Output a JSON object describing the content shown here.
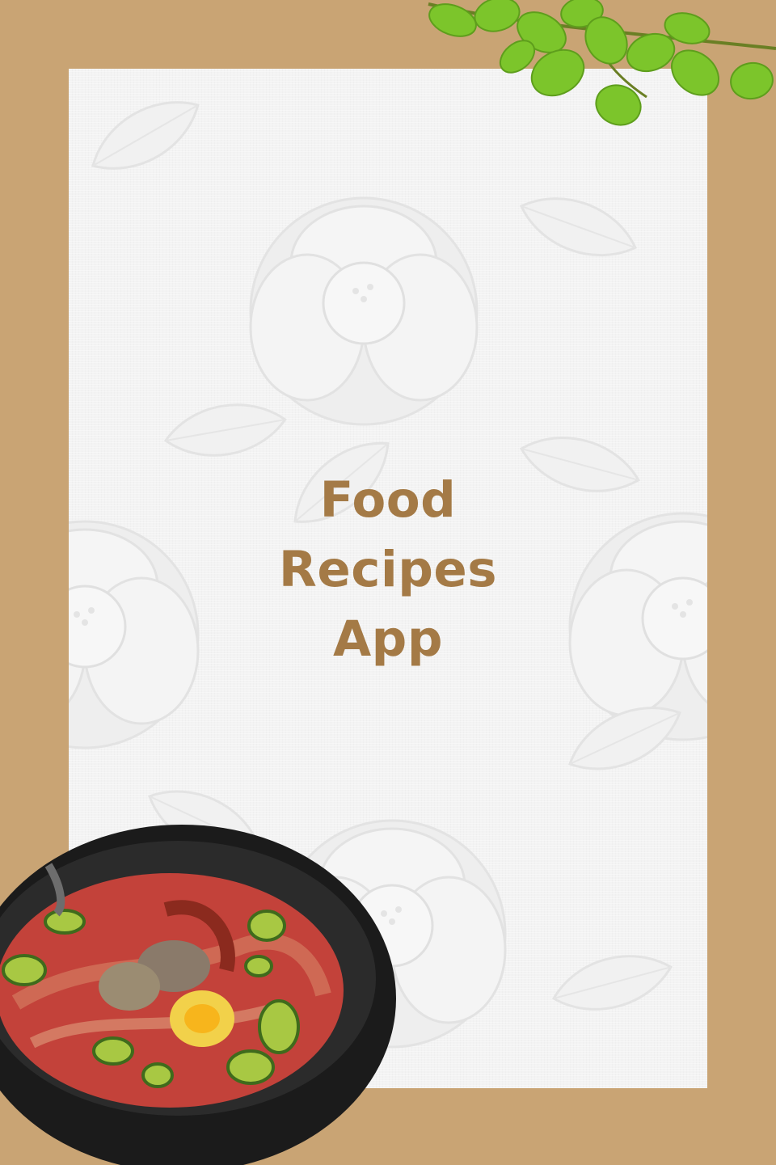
{
  "splash": {
    "title_lines": [
      "Food",
      "Recipes",
      "App"
    ]
  },
  "decor": {
    "frame_icon": "paper-frame",
    "leaves_icon": "leaf-branch-icon",
    "pot_icon": "stew-pot-icon"
  },
  "colors": {
    "frame": "#c9a474",
    "panel": "#f3f3f3",
    "title": "#a47a46",
    "leaf": "#7cc52b",
    "pot": "#1b1b1b",
    "broth": "#c3423a"
  }
}
